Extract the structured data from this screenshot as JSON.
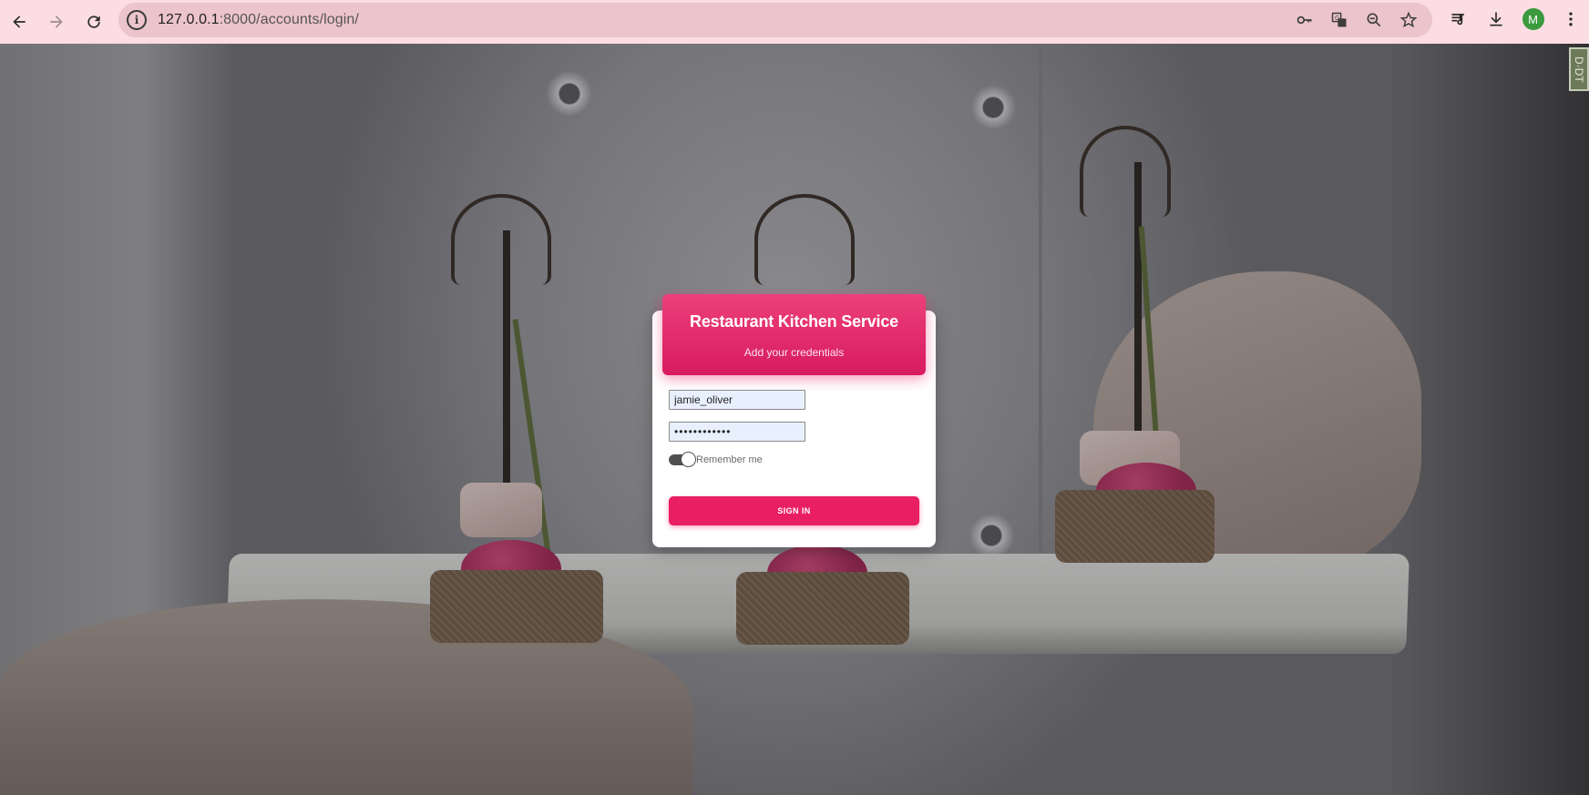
{
  "browser": {
    "url_host": "127.0.0.1",
    "url_path": ":8000/accounts/login/",
    "profile_initial": "M",
    "icons": {
      "back": "back-arrow-icon",
      "forward": "forward-arrow-icon",
      "reload": "reload-icon",
      "site_info": "info-icon",
      "password": "key-icon",
      "translate": "translate-icon",
      "zoom": "zoom-icon",
      "bookmark": "star-icon",
      "media": "media-queue-icon",
      "downloads": "download-icon",
      "menu": "kebab-menu-icon"
    },
    "colors": {
      "toolbar": "#fbdde3",
      "omnibox": "#ecc4cc",
      "avatar": "#3b9a3c"
    }
  },
  "login": {
    "title": "Restaurant Kitchen Service",
    "subtitle": "Add your credentials",
    "username_value": "jamie_oliver",
    "password_value": "••••••••••••",
    "remember_label": "Remember me",
    "remember_checked": true,
    "submit_label": "SIGN IN",
    "colors": {
      "accent": "#e91e63",
      "header_top": "#ec407a",
      "header_bottom": "#d81b60"
    }
  },
  "corner_tag": "D·DT"
}
